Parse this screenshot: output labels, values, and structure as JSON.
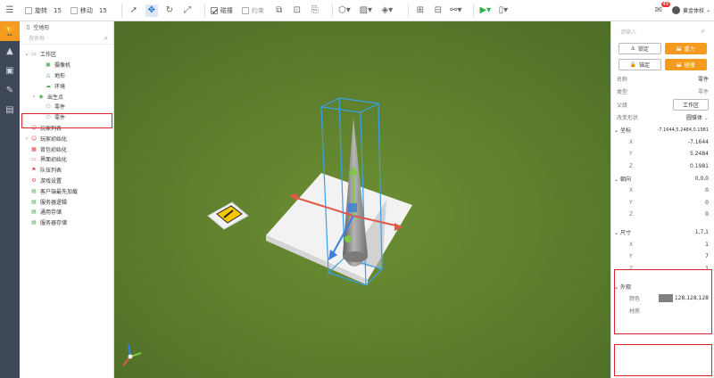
{
  "toolbar": {
    "rotate_label": "旋转",
    "rotate_value": "15",
    "move_label": "移动",
    "move_value": "15",
    "collision_label": "碰撞",
    "constraint_label": "约束",
    "notif_count": "49",
    "username": "黄金体校"
  },
  "tree": {
    "tab_label": "空地形",
    "search_placeholder": "搜索框",
    "nodes": [
      {
        "label": "工作区",
        "arrow": "⌄",
        "icon": "▭",
        "color": "b",
        "indent": 0
      },
      {
        "label": "摄像机",
        "arrow": "",
        "icon": "▣",
        "color": "g",
        "indent": 2
      },
      {
        "label": "地形",
        "arrow": "",
        "icon": "◬",
        "color": "g",
        "indent": 2
      },
      {
        "label": "环境",
        "arrow": "",
        "icon": "☁",
        "color": "g",
        "indent": 2
      },
      {
        "label": "出生点",
        "arrow": "›",
        "icon": "◉",
        "color": "g",
        "indent": 1
      },
      {
        "label": "零件",
        "arrow": "",
        "icon": "⬡",
        "color": "g",
        "indent": 2
      },
      {
        "label": "零件",
        "arrow": "",
        "icon": "⬡",
        "color": "g",
        "indent": 2
      },
      {
        "label": "玩家列表",
        "arrow": "",
        "icon": "☺",
        "color": "r",
        "indent": 0
      },
      {
        "label": "玩家初始化",
        "arrow": "›",
        "icon": "☺",
        "color": "r",
        "indent": 0
      },
      {
        "label": "背包初始化",
        "arrow": "",
        "icon": "▦",
        "color": "r",
        "indent": 0
      },
      {
        "label": "界面初始化",
        "arrow": "",
        "icon": "▭",
        "color": "r",
        "indent": 0
      },
      {
        "label": "队伍列表",
        "arrow": "",
        "icon": "⚑",
        "color": "r",
        "indent": 0
      },
      {
        "label": "游戏设置",
        "arrow": "",
        "icon": "⚙",
        "color": "r",
        "indent": 0
      },
      {
        "label": "客户端最先加载",
        "arrow": "",
        "icon": "▤",
        "color": "g",
        "indent": 0
      },
      {
        "label": "服务器逻辑",
        "arrow": "",
        "icon": "▤",
        "color": "g",
        "indent": 0
      },
      {
        "label": "通用存储",
        "arrow": "",
        "icon": "▤",
        "color": "g",
        "indent": 0
      },
      {
        "label": "服务器存储",
        "arrow": "",
        "icon": "▤",
        "color": "g",
        "indent": 0
      }
    ]
  },
  "props": {
    "search_placeholder": "请输入",
    "lock_label": "锁定",
    "gravity_label": "重力",
    "anchor_label": "锚定",
    "collide_label": "碰撞",
    "name_label": "名称",
    "name_value": "零件",
    "type_label": "类型",
    "type_value": "零件",
    "parent_label": "父级",
    "parent_value": "工作区",
    "shape_label": "改变形状",
    "shape_value": "圆锥体",
    "coord_label": "坐标",
    "coord_value": "-7.1644,5.2484,0.1981",
    "coord_x": "-7.1644",
    "coord_y": "5.2484",
    "coord_z": "0.1981",
    "orient_label": "朝向",
    "orient_value": "0,0,0",
    "orient_x": "0",
    "orient_y": "0",
    "orient_z": "0",
    "size_label": "尺寸",
    "size_value": "1,7,1",
    "size_x": "1",
    "size_y": "7",
    "size_z": "1",
    "look_label": "外观",
    "color_label": "颜色",
    "color_value": "128,128,128",
    "material_label": "材质",
    "x": "X",
    "y": "Y",
    "z": "Z"
  },
  "colors": {
    "accent": "#f39a1f",
    "sidebar": "#3e4756",
    "grass": "#5b7a2d",
    "highlight": "#d9232d",
    "part_color": "#808080"
  }
}
